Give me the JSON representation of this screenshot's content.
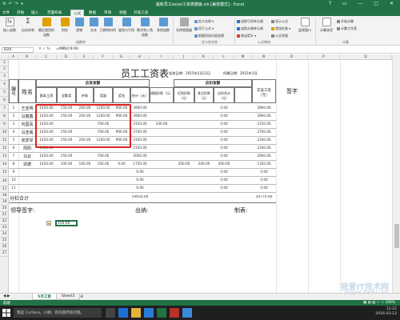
{
  "window": {
    "title": "最新员工excel工资表模板.xls [兼容模式] - Excel",
    "qat": "⟲ ↶ ↷ ▾",
    "controls": "? ▭ — ▢ ✕"
  },
  "ribbon": {
    "tabs": [
      "文件",
      "开始",
      "插入",
      "页面布局",
      "公式",
      "数据",
      "审阅",
      "视图",
      "开发工具"
    ],
    "active_tab": "公式",
    "buttons": [
      {
        "label": "插入函数",
        "icon": "fx-icon",
        "color": "#555"
      },
      {
        "label": "自动求和",
        "icon": "sum-icon",
        "color": "#555"
      },
      {
        "label": "最近使用的函数",
        "icon": "recent-icon",
        "color": "#e0a000"
      },
      {
        "label": "财务",
        "icon": "finance-icon",
        "color": "#e0a000"
      },
      {
        "label": "逻辑",
        "icon": "logic-icon",
        "color": "#5b9bd5"
      },
      {
        "label": "文本",
        "icon": "text-icon",
        "color": "#5b9bd5"
      },
      {
        "label": "日期和时间",
        "icon": "datetime-icon",
        "color": "#5b9bd5"
      },
      {
        "label": "查找与引用",
        "icon": "lookup-icon",
        "color": "#5b9bd5"
      },
      {
        "label": "数学和三角函数",
        "icon": "math-icon",
        "color": "#5b9bd5"
      },
      {
        "label": "其他函数",
        "icon": "more-func-icon",
        "color": "#5b9bd5"
      },
      {
        "label": "名称管理器",
        "icon": "name-manager-icon",
        "color": "#888"
      }
    ],
    "small_left": [
      "定义名称 ▾",
      "用于公式 ▾",
      "根据所选内容创建"
    ],
    "small_right": [
      "追踪引用单元格",
      "追踪从属单元格",
      "移去箭头 ▾",
      "显示公式",
      "错误检查 ▾",
      "公式求值"
    ],
    "watch_label": "监视窗口",
    "calc_label": "计算选项",
    "calc_now": "开始计算",
    "calc_sheet": "计算工作表",
    "groups": [
      "函数库",
      "定义的名称",
      "公式审核",
      "计算"
    ]
  },
  "formula_bar": {
    "name_box": "D20",
    "fx": "✕ ✓ fx",
    "formula": "=MIN(C9:I9)"
  },
  "columns": [
    "A",
    "B",
    "C",
    "D",
    "E",
    "F",
    "G",
    "H",
    "I",
    "J",
    "K",
    "L",
    "M",
    "N",
    "O",
    "P",
    "Q"
  ],
  "rows": [
    "1",
    "2",
    "3",
    "4",
    "5",
    "6",
    "7",
    "8",
    "9",
    "10",
    "11",
    "12",
    "13",
    "14",
    "15",
    "16",
    "17",
    "18",
    "19",
    "20",
    "21",
    "22",
    "23",
    "24",
    "25",
    "26",
    "27"
  ],
  "sheet": {
    "title": "员工工资表",
    "issue_date": "发放日期：2015年2月12日",
    "period": "所属日期：2015年1月",
    "headers": {
      "no": "编号",
      "name": "姓名",
      "payable": "应发金额",
      "deduct": "应扣金额",
      "net": "实发工资（元）",
      "sign": "签字",
      "sub_payable": [
        "基本工资",
        "全勤奖",
        "补助",
        "奖励",
        "奖金",
        "合计（元）"
      ],
      "sub_deduct": [
        "请假扣款（元）",
        "迟到扣款（元）",
        "其它扣款（元）",
        "应扣合计（元）"
      ]
    },
    "records": [
      {
        "no": "1",
        "name": "王亚明",
        "base": "1450.00",
        "attend": "150.00",
        "allow": "200.00",
        "reward": "1200.00",
        "bonus": "900.00",
        "total": "3900.00",
        "leave": "",
        "late": "",
        "other": "",
        "dsum": "0.00",
        "net": "3900.00"
      },
      {
        "no": "2",
        "name": "马丽鑫",
        "base": "1450.00",
        "attend": "150.00",
        "allow": "200.00",
        "reward": "1200.00",
        "bonus": "900.00",
        "total": "3900.00",
        "leave": "",
        "late": "",
        "other": "",
        "dsum": "0.00",
        "net": "3900.00"
      },
      {
        "no": "3",
        "name": "刘国喜",
        "base": "1450.00",
        "attend": "",
        "allow": "",
        "reward": "700.00",
        "bonus": "",
        "total": "2150.00",
        "leave": "330.00",
        "late": "",
        "other": "",
        "dsum": "0.00",
        "net": "2150.00"
      },
      {
        "no": "4",
        "name": "马亚威",
        "base": "1450.00",
        "attend": "150.00",
        "allow": "",
        "reward": "700.00",
        "bonus": "900.00",
        "total": "2700.00",
        "leave": "",
        "late": "",
        "other": "",
        "dsum": "0.00",
        "net": "2700.00"
      },
      {
        "no": "5",
        "name": "张爱琴",
        "base": "1450.00",
        "attend": "150.00",
        "allow": "200.00",
        "reward": "1200.00",
        "bonus": "900.00",
        "total": "2100.00",
        "leave": "",
        "late": "",
        "other": "",
        "dsum": "0.00",
        "net": "2100.00"
      },
      {
        "no": "6",
        "name": "周阳",
        "base": "1450.00",
        "attend": "",
        "allow": "",
        "reward": "",
        "bonus": "",
        "total": "2100.00",
        "leave": "",
        "late": "",
        "other": "",
        "dsum": "0.00",
        "net": "2100.00"
      },
      {
        "no": "7",
        "name": "马云",
        "base": "1450.00",
        "attend": "150.00",
        "allow": "",
        "reward": "700.00",
        "bonus": "",
        "total": "2000.00",
        "leave": "",
        "late": "",
        "other": "",
        "dsum": "0.00",
        "net": "2000.00"
      },
      {
        "no": "8",
        "name": "邓德",
        "base": "1450.00",
        "attend": "100.00",
        "allow": "100.00",
        "reward": "100.00",
        "bonus": "0.00",
        "total": "1750.00",
        "leave": "",
        "late": "200.00",
        "other": "200.00",
        "dsum": "400.00",
        "net": "1350.00"
      },
      {
        "no": "9",
        "name": "",
        "base": "",
        "attend": "",
        "allow": "",
        "reward": "",
        "bonus": "",
        "total": "0.00",
        "leave": "",
        "late": "",
        "other": "",
        "dsum": "0.00",
        "net": "0.00"
      },
      {
        "no": "10",
        "name": "",
        "base": "",
        "attend": "",
        "allow": "",
        "reward": "",
        "bonus": "",
        "total": "0.00",
        "leave": "",
        "late": "",
        "other": "",
        "dsum": "0.00",
        "net": "0.00"
      },
      {
        "no": "11",
        "name": "",
        "base": "",
        "attend": "",
        "allow": "",
        "reward": "",
        "bonus": "",
        "total": "0.00",
        "leave": "",
        "late": "",
        "other": "",
        "dsum": "0.00",
        "net": "0.00"
      }
    ],
    "subtotal_label": "分栏合计",
    "subtotal_total": "19650.00",
    "subtotal_net": "19770.00",
    "leader_sign": "领导签字:",
    "cashier": "出纳:",
    "preparer": "制表:",
    "active_cell_value": "150.00"
  },
  "sheet_tabs": {
    "nav": "◀ ▶",
    "tabs": [
      "5月工资",
      "Sheet3"
    ],
    "add": "⊕"
  },
  "status": {
    "left": "就绪",
    "right": "▦ ▤ ▥  —  +  100%"
  },
  "taskbar": {
    "search_placeholder": "我是 Cortana，小娜。有问题尽管问我。",
    "time": "12:22",
    "date": "2016-03-12",
    "watermark": "我爱IT技术网",
    "watermark_url": "jingyan.baidu.com"
  },
  "colors": {
    "excel_green": "#217346",
    "red_highlight": "#e02020",
    "grid": "#e4e4e4"
  }
}
